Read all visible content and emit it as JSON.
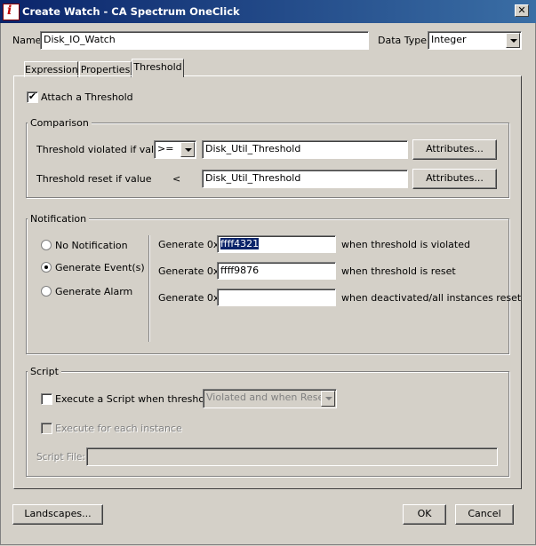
{
  "window": {
    "title": "Create Watch - CA Spectrum OneClick",
    "close_glyph": "✕"
  },
  "name_row": {
    "name_label": "Name",
    "name_value": "Disk_IO_Watch",
    "datatype_label": "Data Type",
    "datatype_value": "Integer"
  },
  "tabs": [
    {
      "label": "Expression",
      "active": false
    },
    {
      "label": "Properties",
      "active": false
    },
    {
      "label": "Threshold",
      "active": true
    }
  ],
  "attach": {
    "label": "Attach a Threshold",
    "checked": true
  },
  "comparison": {
    "group_label": "Comparison",
    "violated_label": "Threshold violated if value",
    "violated_operator": ">=",
    "violated_value": "Disk_Util_Threshold",
    "reset_label": "Threshold reset if value",
    "reset_operator": "<",
    "reset_value": "Disk_Util_Threshold",
    "attributes_label": "Attributes..."
  },
  "notification": {
    "group_label": "Notification",
    "options": [
      "No Notification",
      "Generate Event(s)",
      "Generate Alarm"
    ],
    "selected_index": 1,
    "generate_label": "Generate 0x",
    "violated_code": "ffff4321",
    "violated_suffix": "when threshold is violated",
    "reset_code": "ffff9876",
    "reset_suffix": "when threshold is reset",
    "deactivated_code": "",
    "deactivated_suffix": "when deactivated/all instances reset"
  },
  "script": {
    "group_label": "Script",
    "execute_label": "Execute a Script when threshold",
    "execute_checked": false,
    "when_value": "Violated and when Reset",
    "each_instance_label": "Execute for each instance",
    "script_file_label": "Script File:",
    "script_file_value": ""
  },
  "footer": {
    "landscapes_label": "Landscapes...",
    "ok_label": "OK",
    "cancel_label": "Cancel"
  },
  "icons": {
    "app_icon": "info-i-icon"
  }
}
